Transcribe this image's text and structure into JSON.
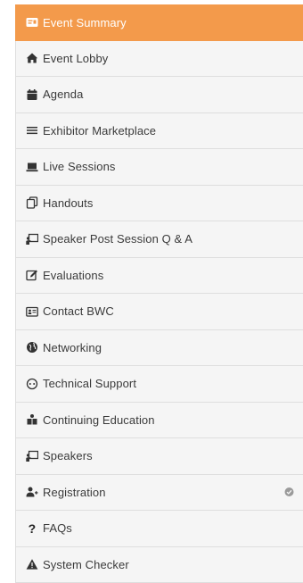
{
  "sidebar": {
    "items": [
      {
        "label": "Event Summary",
        "icon": "summary-card-icon",
        "active": true
      },
      {
        "label": "Event Lobby",
        "icon": "home-icon"
      },
      {
        "label": "Agenda",
        "icon": "calendar-icon"
      },
      {
        "label": "Exhibitor Marketplace",
        "icon": "list-icon"
      },
      {
        "label": "Live Sessions",
        "icon": "laptop-icon"
      },
      {
        "label": "Handouts",
        "icon": "copy-icon"
      },
      {
        "label": "Speaker Post Session Q & A",
        "icon": "presentation-icon"
      },
      {
        "label": "Evaluations",
        "icon": "edit-icon"
      },
      {
        "label": "Contact BWC",
        "icon": "contact-card-icon"
      },
      {
        "label": "Networking",
        "icon": "globe-icon"
      },
      {
        "label": "Technical Support",
        "icon": "support-icon"
      },
      {
        "label": "Continuing Education",
        "icon": "education-icon"
      },
      {
        "label": "Speakers",
        "icon": "presentation-icon"
      },
      {
        "label": "Registration",
        "icon": "user-add-icon",
        "badge": "check-circle-icon"
      },
      {
        "label": "FAQs",
        "icon": "question-icon"
      },
      {
        "label": "System Checker",
        "icon": "warning-icon"
      }
    ]
  },
  "colors": {
    "active_bg": "#f39a4b",
    "item_bg": "#f5f5f5",
    "border": "#dedede",
    "text": "#3a3a3a",
    "badge": "#9a9a9a"
  }
}
